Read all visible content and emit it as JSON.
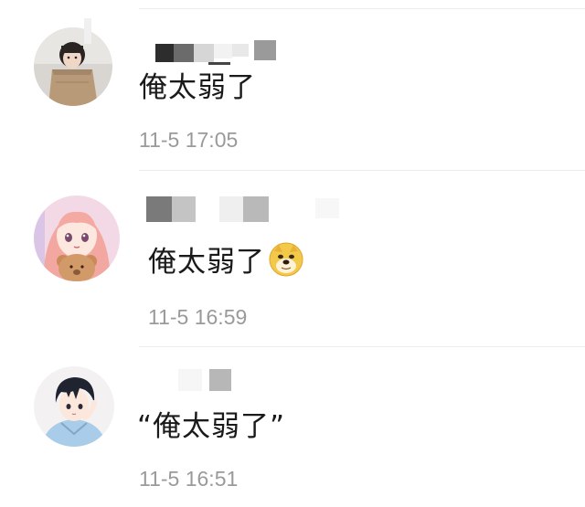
{
  "comments": [
    {
      "username": "",
      "text": "俺太弱了",
      "time": "11-5 17:05",
      "avatar_icon": "girl-with-paper-bag-avatar"
    },
    {
      "username": "",
      "text": "俺太弱了",
      "time": "11-5 16:59",
      "avatar_icon": "anime-girl-with-teddy-bear-avatar",
      "emoji_icon": "doge-emoji"
    },
    {
      "username": "",
      "text": "“俺太弱了”",
      "time": "11-5 16:51",
      "avatar_icon": "anime-boy-avatar"
    }
  ],
  "colors": {
    "text": "#1a1a1a",
    "timestamp": "#9a9a9a",
    "divider": "#ececec",
    "background": "#ffffff"
  }
}
